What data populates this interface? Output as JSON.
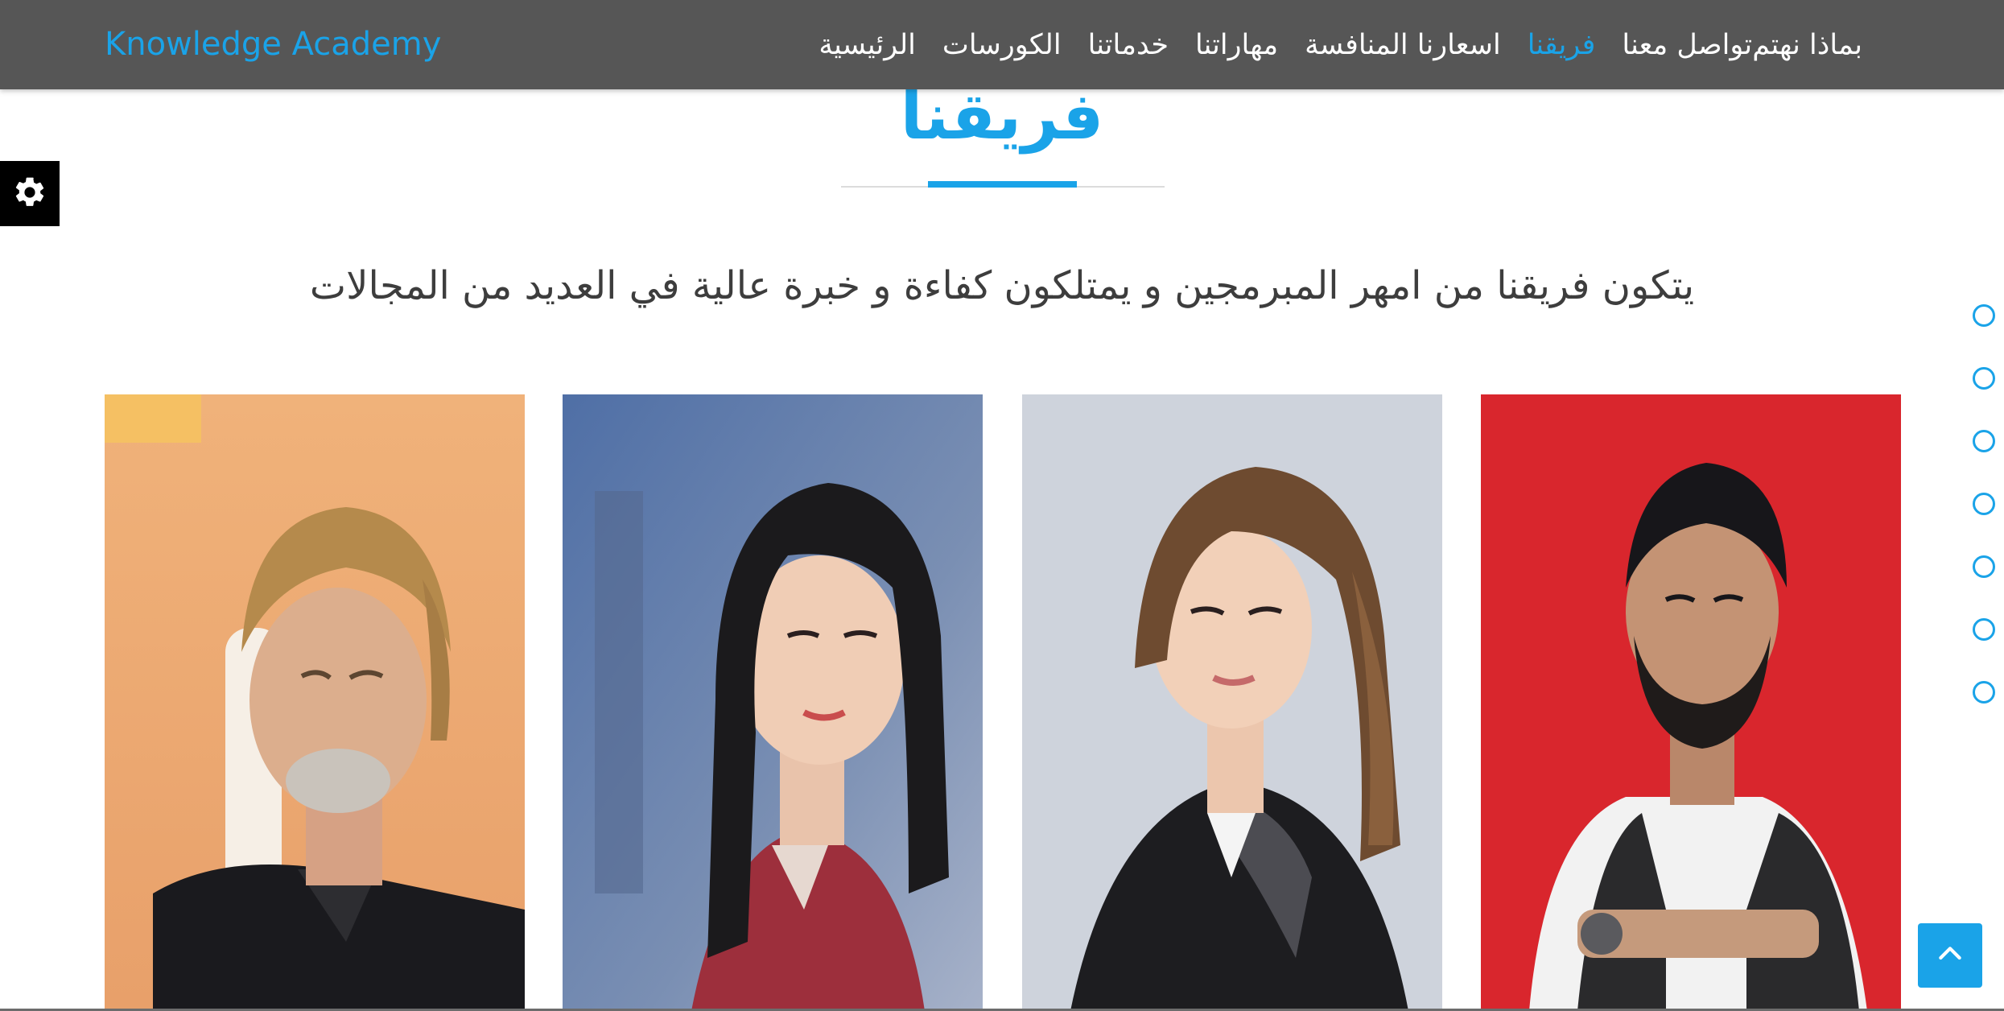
{
  "navbar": {
    "brand": "Knowledge Academy",
    "links": [
      {
        "label": "الرئيسية"
      },
      {
        "label": "الكورسات"
      },
      {
        "label": "خدماتنا"
      },
      {
        "label": "مهاراتنا"
      },
      {
        "label": "اسعارنا المنافسة"
      },
      {
        "label": "فريقنا",
        "active": true
      },
      {
        "label": "تواصل معنا"
      },
      {
        "label": "بماذا نهتم"
      }
    ]
  },
  "team": {
    "title": "فريقنا",
    "description": "يتكون فريقنا من امهر المبرمجين و يمتلكون كفاءة و خبرة عالية في العديد من المجالات",
    "members": [
      {
        "photo": "team-photo-1"
      },
      {
        "photo": "team-photo-2"
      },
      {
        "photo": "team-photo-3"
      },
      {
        "photo": "team-photo-4"
      }
    ]
  },
  "side_dots": {
    "count": 7
  },
  "icons": {
    "settings": "gear-icon",
    "back_to_top": "chevron-up-icon"
  },
  "colors": {
    "accent": "#1aa3e8",
    "navbar_bg": "#565656",
    "text": "#3d3d3d"
  }
}
